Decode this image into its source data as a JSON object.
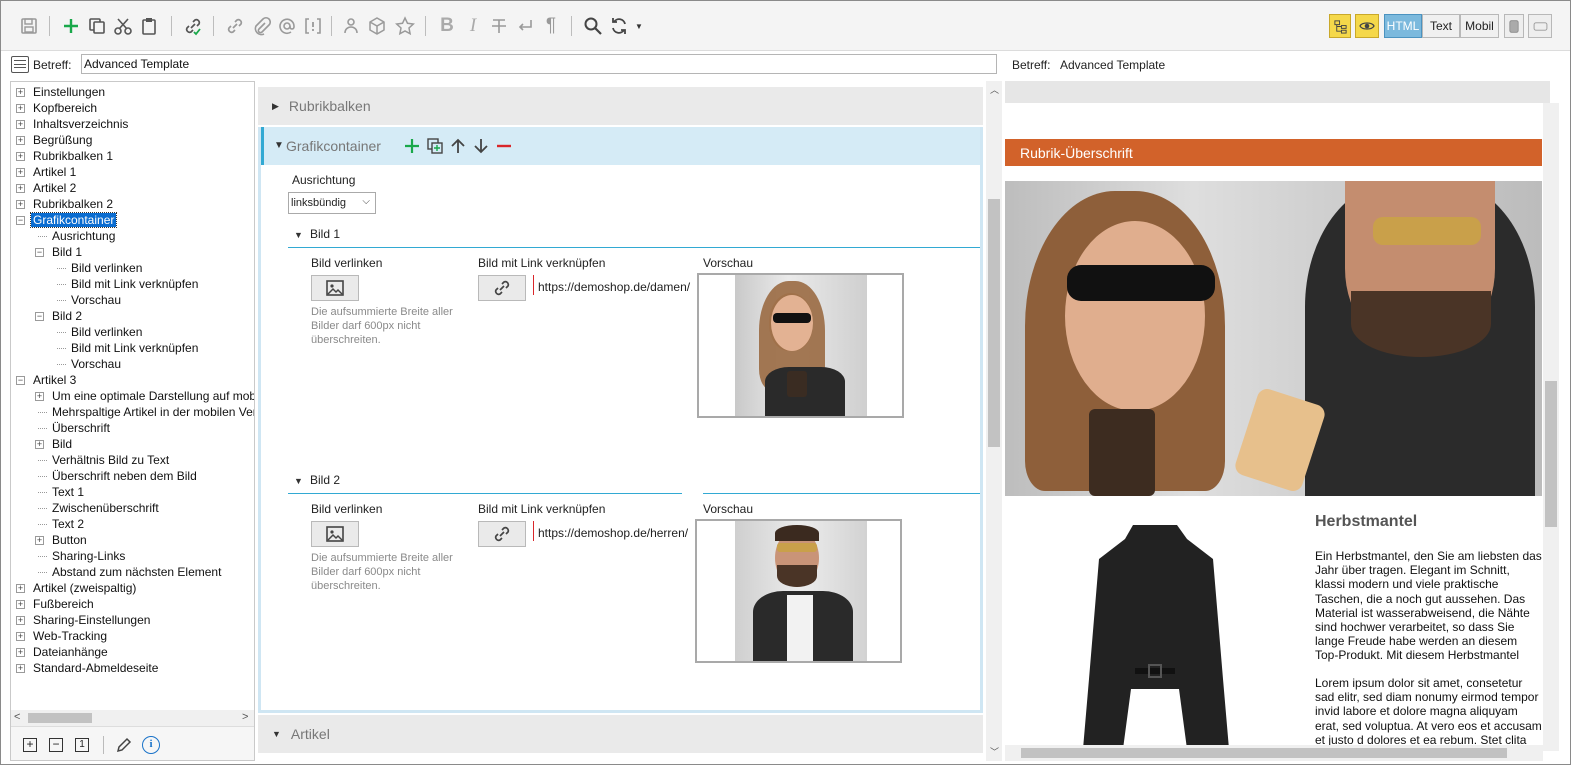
{
  "toolbar": {
    "icons": [
      "save-icon",
      "add-icon",
      "copy-icon",
      "cut-icon",
      "paste-icon",
      "link-check-icon",
      "link-icon",
      "attach-icon",
      "at-icon",
      "placeholder-icon",
      "person-icon",
      "package-icon",
      "star-icon",
      "bold-icon",
      "italic-icon",
      "strikethrough-icon",
      "return-icon",
      "pilcrow-icon",
      "search-icon",
      "refresh-icon",
      "dropdown-caret-icon"
    ],
    "view_html": "HTML",
    "view_text": "Text",
    "view_mobile": "Mobil"
  },
  "subject": {
    "label": "Betreff:",
    "value": "Advanced Template"
  },
  "preview_subject": {
    "label": "Betreff:",
    "value": "Advanced Template"
  },
  "tree": [
    {
      "label": "Einstellungen",
      "level": 0,
      "expander": "+"
    },
    {
      "label": "Kopfbereich",
      "level": 0,
      "expander": "+"
    },
    {
      "label": "Inhaltsverzeichnis",
      "level": 0,
      "expander": "+"
    },
    {
      "label": "Begrüßung",
      "level": 0,
      "expander": "+"
    },
    {
      "label": "Rubrikbalken 1",
      "level": 0,
      "expander": "+"
    },
    {
      "label": "Artikel 1",
      "level": 0,
      "expander": "+"
    },
    {
      "label": "Artikel 2",
      "level": 0,
      "expander": "+"
    },
    {
      "label": "Rubrikbalken 2",
      "level": 0,
      "expander": "+"
    },
    {
      "label": "Grafikcontainer",
      "level": 0,
      "expander": "-",
      "selected": true
    },
    {
      "label": "Ausrichtung",
      "level": 1,
      "expander": ""
    },
    {
      "label": "Bild 1",
      "level": 1,
      "expander": "-"
    },
    {
      "label": "Bild verlinken",
      "level": 2,
      "expander": ""
    },
    {
      "label": "Bild mit Link verknüpfen",
      "level": 2,
      "expander": ""
    },
    {
      "label": "Vorschau",
      "level": 2,
      "expander": ""
    },
    {
      "label": "Bild 2",
      "level": 1,
      "expander": "-"
    },
    {
      "label": "Bild verlinken",
      "level": 2,
      "expander": ""
    },
    {
      "label": "Bild mit Link verknüpfen",
      "level": 2,
      "expander": ""
    },
    {
      "label": "Vorschau",
      "level": 2,
      "expander": ""
    },
    {
      "label": "Artikel 3",
      "level": 0,
      "expander": "-"
    },
    {
      "label": "Um eine optimale Darstellung auf mobiler",
      "level": 1,
      "expander": "+"
    },
    {
      "label": "Mehrspaltige Artikel in der mobilen Versic",
      "level": 1,
      "expander": ""
    },
    {
      "label": "Überschrift",
      "level": 1,
      "expander": ""
    },
    {
      "label": "Bild",
      "level": 1,
      "expander": "+"
    },
    {
      "label": "Verhältnis Bild zu Text",
      "level": 1,
      "expander": ""
    },
    {
      "label": "Überschrift neben dem Bild",
      "level": 1,
      "expander": ""
    },
    {
      "label": "Text 1",
      "level": 1,
      "expander": ""
    },
    {
      "label": "Zwischenüberschrift",
      "level": 1,
      "expander": ""
    },
    {
      "label": "Text 2",
      "level": 1,
      "expander": ""
    },
    {
      "label": "Button",
      "level": 1,
      "expander": "+"
    },
    {
      "label": "Sharing-Links",
      "level": 1,
      "expander": ""
    },
    {
      "label": "Abstand zum nächsten Element",
      "level": 1,
      "expander": ""
    },
    {
      "label": "Artikel (zweispaltig)",
      "level": 0,
      "expander": "+"
    },
    {
      "label": "Fußbereich",
      "level": 0,
      "expander": "+"
    },
    {
      "label": "Sharing-Einstellungen",
      "level": 0,
      "expander": "+"
    },
    {
      "label": "Web-Tracking",
      "level": 0,
      "expander": "+"
    },
    {
      "label": "Dateianhänge",
      "level": 0,
      "expander": "+"
    },
    {
      "label": "Standard-Abmeldeseite",
      "level": 0,
      "expander": "+"
    }
  ],
  "tree_footer_icons": [
    "expand-all-icon",
    "collapse-all-icon",
    "level-one-icon",
    "edit-icon",
    "info-icon"
  ],
  "editor": {
    "section_rubrik": "Rubrikbalken",
    "section_grafik": "Grafikcontainer",
    "alignment_label": "Ausrichtung",
    "alignment_value": "linksbündig",
    "bild1": {
      "title": "Bild 1",
      "link_image_label": "Bild verlinken",
      "link_url_label": "Bild mit Link verknüpfen",
      "preview_label": "Vorschau",
      "hint": "Die aufsummierte Breite aller Bilder darf 600px nicht überschreiten.",
      "url": "https://demoshop.de/damen/"
    },
    "bild2": {
      "title": "Bild 2",
      "link_image_label": "Bild verlinken",
      "link_url_label": "Bild mit Link verknüpfen",
      "preview_label": "Vorschau",
      "hint": "Die aufsummierte Breite aller Bilder darf 600px nicht überschreiten.",
      "url": "https://demoshop.de/herren/"
    },
    "section_artikel": "Artikel"
  },
  "preview": {
    "rubrik_heading": "Rubrik-Überschrift",
    "article_title": "Herbstmantel",
    "para1": "Ein Herbstmantel, den Sie am liebsten das Jahr über tragen. Elegant im Schnitt, klassi modern und viele praktische Taschen, die a noch gut aussehen. Das Material ist wasserabweisend, die Nähte sind hochwer verarbeitet, so dass Sie lange Freude habe werden an diesem Top-Produkt. Mit diesem Herbstmantel machen Sie immer eine gute",
    "para2": "Lorem ipsum dolor sit amet, consetetur sad elitr, sed diam nonumy eirmod tempor invid labore et dolore magna aliquyam erat, sed voluptua. At vero eos et accusam et justo d dolores et ea rebum. Stet clita kasd guberg"
  },
  "colors": {
    "accent_blue": "#32a9d3",
    "rubrik_orange": "#d2622a",
    "add_green": "#19a84a",
    "remove_red": "#d9262a",
    "select_bg": "#0a6cd0"
  }
}
